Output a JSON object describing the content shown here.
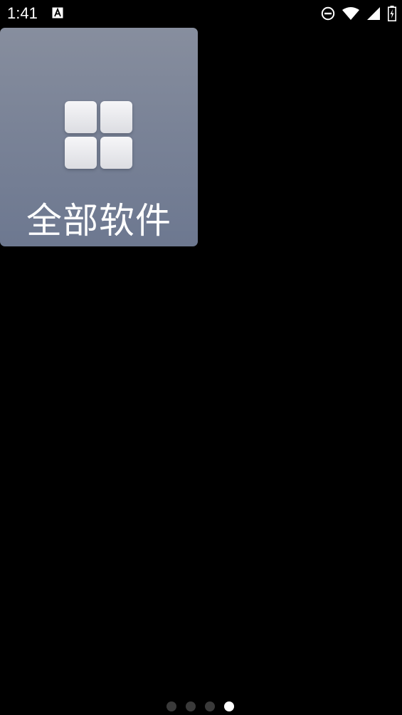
{
  "status_bar": {
    "time": "1:41",
    "notification_icon": "a-with-box-icon",
    "icons": [
      "do-not-disturb-icon",
      "wifi-icon",
      "signal-icon",
      "battery-charging-icon"
    ]
  },
  "launcher": {
    "tile": {
      "label": "全部软件",
      "icon": "grid-icon",
      "gradient_top": "#878e9e",
      "gradient_bottom": "#6d7890"
    }
  },
  "page_indicator": {
    "count": 4,
    "active_index": 3
  }
}
